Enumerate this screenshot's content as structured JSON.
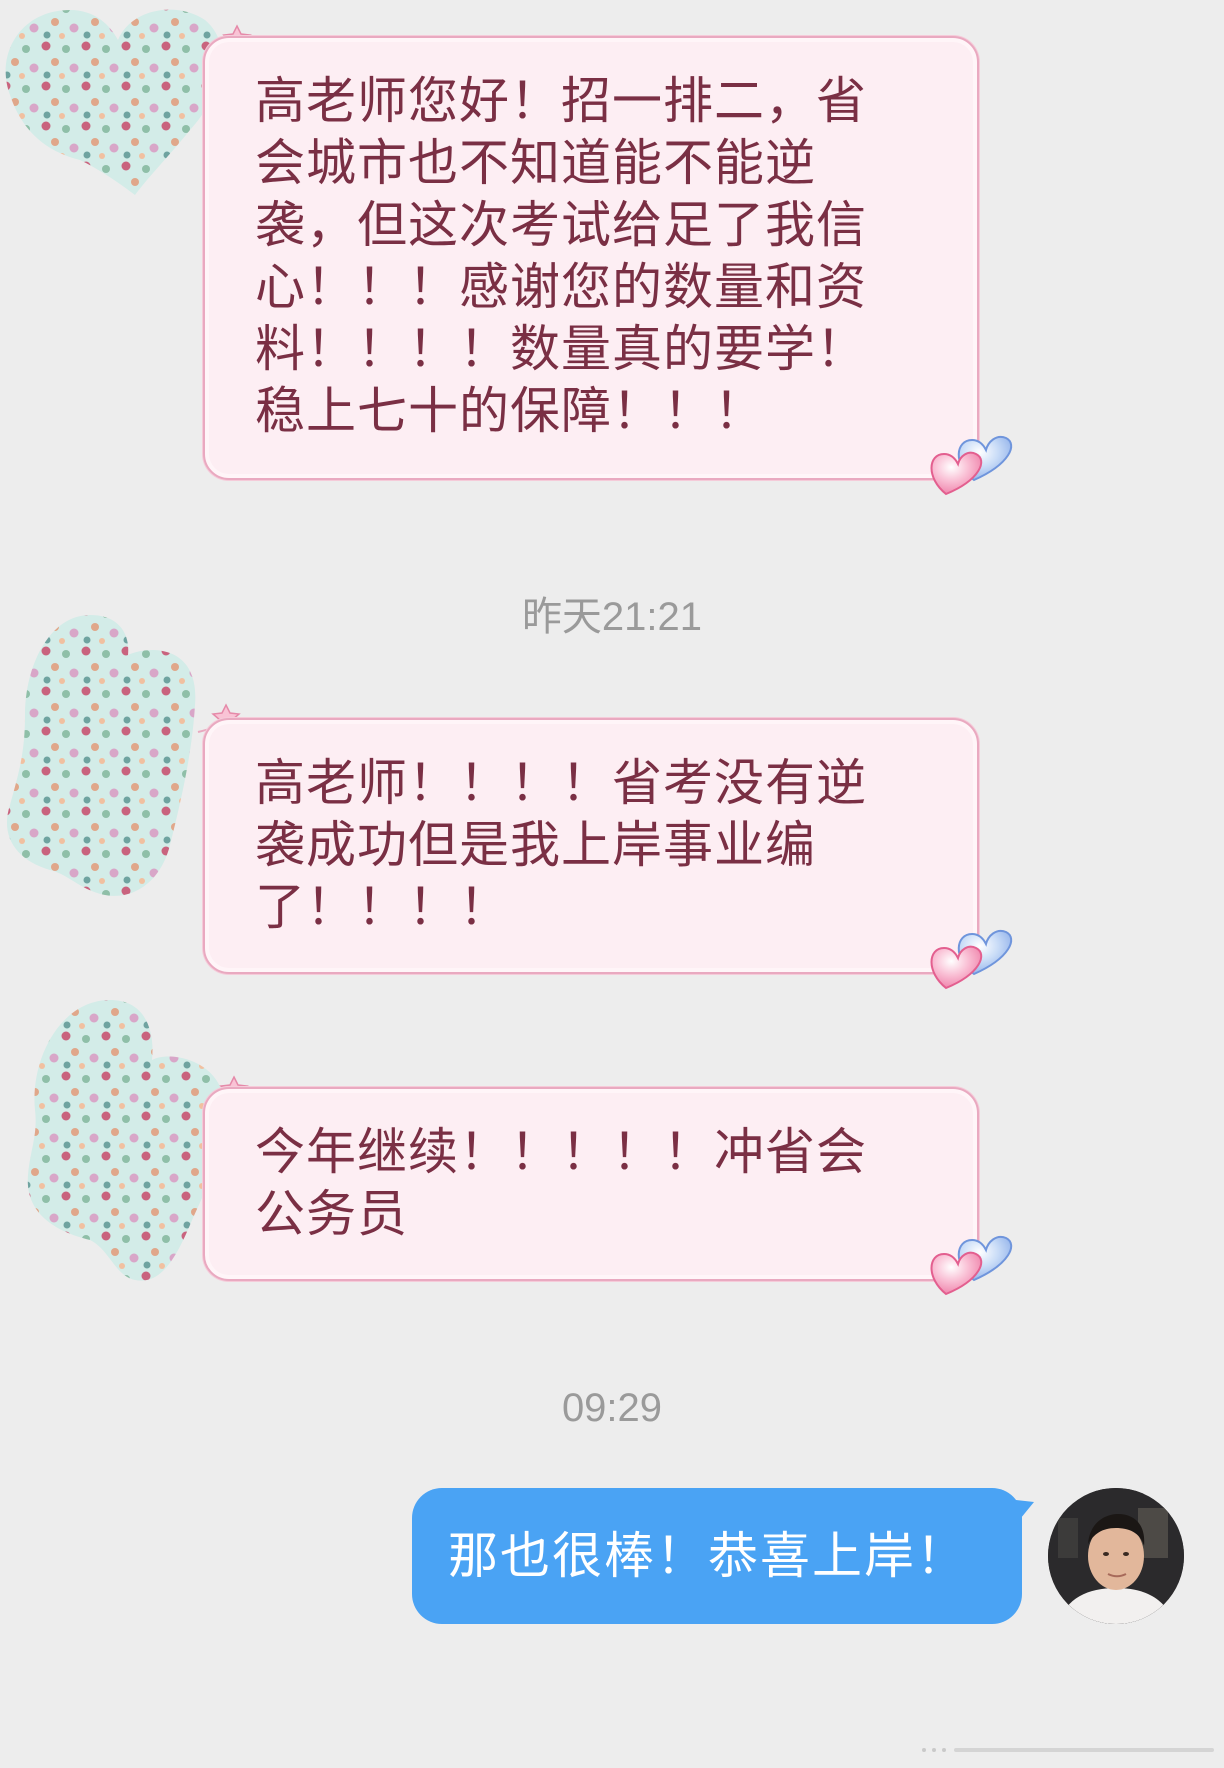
{
  "messages": [
    {
      "text": "高老师您好！招一排二，省会城市也不知道能不能逆袭，但这次考试给足了我信心！！！感谢您的数量和资料！！！！数量真的要学！稳上七十的保障！！！"
    },
    {
      "timestamp": "昨天21:21"
    },
    {
      "text": "高老师！！！！省考没有逆袭成功但是我上岸事业编了！！！！"
    },
    {
      "text": "今年继续！！！！！冲省会公务员"
    },
    {
      "timestamp": "09:29"
    },
    {
      "text": "那也很棒！恭喜上岸！"
    }
  ],
  "colors": {
    "background": "#ededed",
    "incoming_bubble": "#fdeef3",
    "incoming_border": "#e9a9c0",
    "incoming_text": "#7a2f44",
    "outgoing_bubble": "#4aa3f4",
    "outgoing_text": "#ffffff",
    "timestamp_text": "#9a9a9a"
  },
  "icons": [
    "polka-dot-heart-avatar-icon",
    "heart-pair-icon",
    "star-icon",
    "user-photo-avatar"
  ]
}
